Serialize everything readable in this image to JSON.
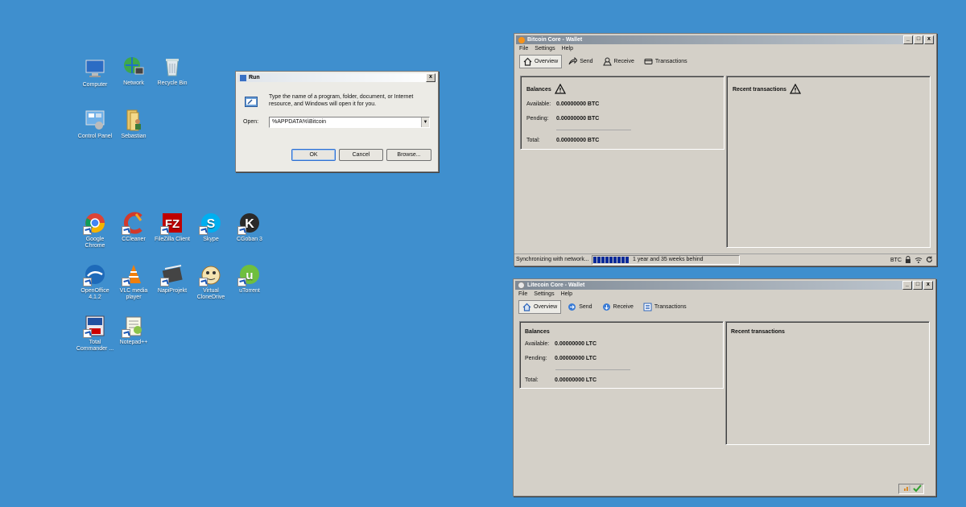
{
  "desktop": {
    "icons": [
      {
        "label": "Computer",
        "icon": "computer-icon"
      },
      {
        "label": "Network",
        "icon": "network-icon"
      },
      {
        "label": "Recycle Bin",
        "icon": "recycle-bin-icon"
      },
      {
        "label": "Control Panel",
        "icon": "control-panel-icon"
      },
      {
        "label": "Sebastian",
        "icon": "user-folder-icon"
      },
      {
        "label": "Google Chrome",
        "icon": "chrome-icon"
      },
      {
        "label": "CCleaner",
        "icon": "ccleaner-icon"
      },
      {
        "label": "FileZilla Client",
        "icon": "filezilla-icon"
      },
      {
        "label": "Skype",
        "icon": "skype-icon"
      },
      {
        "label": "CGoban 3",
        "icon": "cgoban-icon"
      },
      {
        "label": "OpenOffice 4.1.2",
        "icon": "openoffice-icon"
      },
      {
        "label": "VLC media player",
        "icon": "vlc-icon"
      },
      {
        "label": "NapiProjekt",
        "icon": "napiprojekt-icon"
      },
      {
        "label": "Virtual CloneDrive",
        "icon": "clonedrive-icon"
      },
      {
        "label": "uTorrent",
        "icon": "utorrent-icon"
      },
      {
        "label": "Total Commander ...",
        "icon": "total-commander-icon"
      },
      {
        "label": "Notepad++",
        "icon": "notepadpp-icon"
      }
    ]
  },
  "run_dialog": {
    "title": "Run",
    "description": "Type the name of a program, folder, document, or Internet resource, and Windows will open it for you.",
    "open_label": "Open:",
    "open_value": "%APPDATA%\\Bitcoin",
    "ok": "OK",
    "cancel": "Cancel",
    "browse": "Browse...",
    "close": "x"
  },
  "bitcoin": {
    "title": "Bitcoin Core - Wallet",
    "menu": [
      "File",
      "Settings",
      "Help"
    ],
    "tabs": [
      "Overview",
      "Send",
      "Receive",
      "Transactions"
    ],
    "balances_title": "Balances",
    "available_label": "Available:",
    "available_value": "0.00000000 BTC",
    "pending_label": "Pending:",
    "pending_value": "0.00000000 BTC",
    "total_label": "Total:",
    "total_value": "0.00000000 BTC",
    "recent_title": "Recent transactions",
    "status_sync": "Synchronizing with network...",
    "status_behind": "1 year and 35 weeks behind",
    "status_unit": "BTC",
    "sync_progress_segments": 9,
    "accent": "#f7931a"
  },
  "litecoin": {
    "title": "Litecoin Core - Wallet",
    "menu": [
      "File",
      "Settings",
      "Help"
    ],
    "tabs": [
      "Overview",
      "Send",
      "Receive",
      "Transactions"
    ],
    "balances_title": "Balances",
    "available_label": "Available:",
    "available_value": "0.00000000 LTC",
    "pending_label": "Pending:",
    "pending_value": "0.00000000 LTC",
    "total_label": "Total:",
    "total_value": "0.00000000 LTC",
    "recent_title": "Recent transactions",
    "accent": "#bfbbbb"
  },
  "window_buttons": {
    "min": "_",
    "max": "□",
    "close": "x"
  }
}
